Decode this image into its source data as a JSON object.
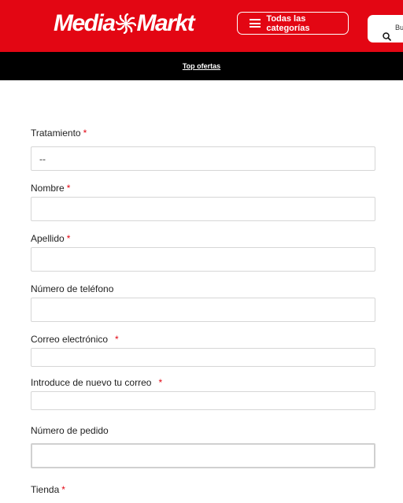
{
  "header": {
    "logo_left": "Media",
    "logo_right": "Markt",
    "categories_label": "Todas las categorías",
    "search_text": "Bu"
  },
  "topbar": {
    "link": "Top ofertas"
  },
  "form": {
    "tratamiento": {
      "label": "Tratamiento",
      "value": "--"
    },
    "nombre": {
      "label": "Nombre"
    },
    "apellido": {
      "label": "Apellido"
    },
    "telefono": {
      "label": "Número de teléfono"
    },
    "correo": {
      "label": "Correo electrónico"
    },
    "correo_repeat": {
      "label": "Introduce de nuevo tu correo"
    },
    "pedido": {
      "label": "Número de pedido"
    },
    "tienda": {
      "label": "Tienda"
    },
    "required_mark": "*"
  },
  "colors": {
    "brand_red": "#e30613",
    "bar_black": "#000000"
  }
}
